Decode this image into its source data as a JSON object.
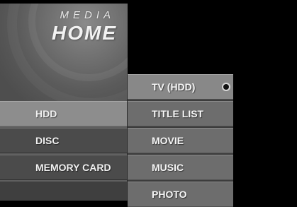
{
  "banner": {
    "title_top": "MEDIA",
    "title_main": "HOME"
  },
  "main_menu": {
    "items": [
      {
        "label": "HDD",
        "active": true
      },
      {
        "label": "DISC",
        "active": false
      },
      {
        "label": "MEMORY CARD",
        "active": false
      }
    ]
  },
  "sub_menu": {
    "items": [
      {
        "label": "TV (HDD)",
        "selected": true
      },
      {
        "label": "TITLE LIST",
        "selected": false
      },
      {
        "label": "MOVIE",
        "selected": false
      },
      {
        "label": "MUSIC",
        "selected": false
      },
      {
        "label": "PHOTO",
        "selected": false
      }
    ]
  },
  "colors": {
    "background": "#000000",
    "panel": "#5f5f5f",
    "active_item": "#8d8d8d",
    "item": "#4b4b4b",
    "text": "#f0f0f0"
  }
}
